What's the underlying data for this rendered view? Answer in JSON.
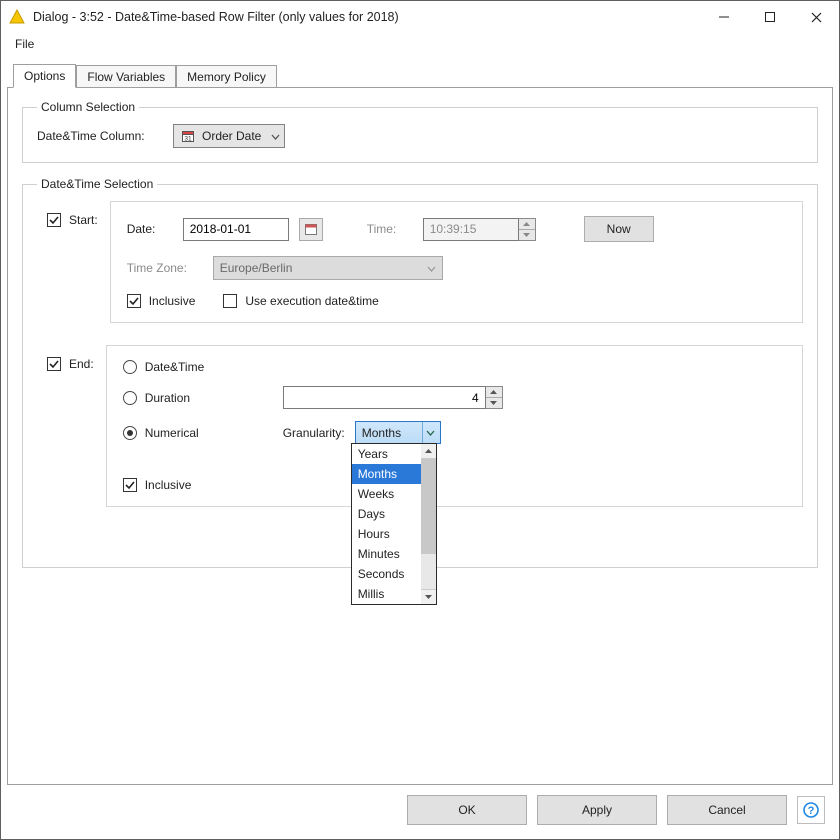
{
  "window": {
    "title": "Dialog - 3:52 - Date&Time-based Row Filter (only values for 2018)"
  },
  "menubar": {
    "file": "File"
  },
  "tabs": {
    "options": "Options",
    "flow_variables": "Flow Variables",
    "memory_policy": "Memory Policy"
  },
  "column_selection": {
    "legend": "Column Selection",
    "label": "Date&Time Column:",
    "value": "Order Date"
  },
  "datetime_selection": {
    "legend": "Date&Time Selection",
    "start": {
      "check_label": "Start:",
      "date_label": "Date:",
      "date_value": "2018-01-01",
      "time_label": "Time:",
      "time_value": "10:39:15",
      "now_button": "Now",
      "tz_label": "Time Zone:",
      "tz_value": "Europe/Berlin",
      "inclusive_label": "Inclusive",
      "use_exec_label": "Use execution date&time",
      "start_checked": true,
      "inclusive_checked": true,
      "use_exec_checked": false
    },
    "end": {
      "check_label": "End:",
      "radio_datetime": "Date&Time",
      "radio_duration": "Duration",
      "radio_numerical": "Numerical",
      "numeric_value": "4",
      "granularity_label": "Granularity:",
      "granularity_value": "Months",
      "granularity_options": [
        "Years",
        "Months",
        "Weeks",
        "Days",
        "Hours",
        "Minutes",
        "Seconds",
        "Millis"
      ],
      "inclusive_label": "Inclusive",
      "end_checked": true,
      "inclusive_checked": true,
      "selected_radio": "numerical"
    }
  },
  "buttons": {
    "ok": "OK",
    "apply": "Apply",
    "cancel": "Cancel"
  },
  "colors": {
    "accent": "#2a78d8"
  }
}
